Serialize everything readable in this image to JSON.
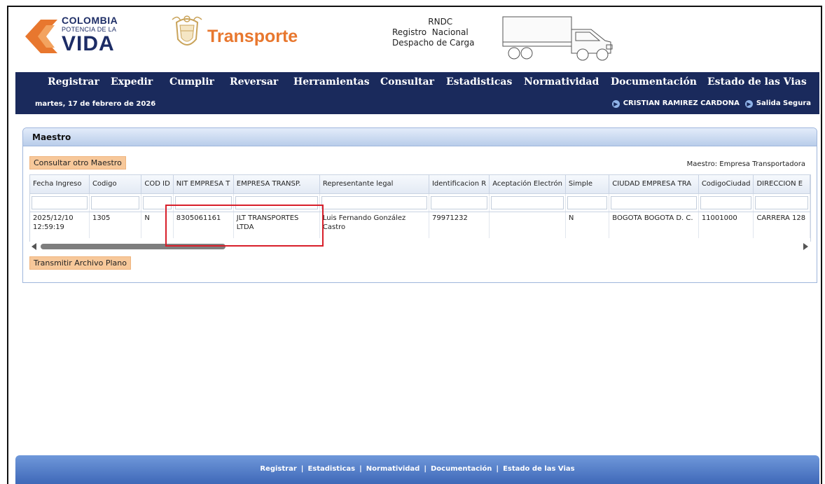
{
  "header": {
    "logo_line1": "COLOMBIA",
    "logo_line2": "POTENCIA DE LA",
    "logo_line3": "VIDA",
    "ministry": "Transporte",
    "rndc_title": "RNDC",
    "rndc_line1a": "Registro",
    "rndc_line1b": "Nacional",
    "rndc_line2": "Despacho de Carga"
  },
  "menu": {
    "items": [
      "Registrar",
      "Expedir",
      "Cumplir",
      "Reversar",
      "Herramientas",
      "Consultar",
      "Estadisticas",
      "Normatividad",
      "Documentación",
      "Estado de las Vias"
    ]
  },
  "subbar": {
    "date": "martes, 17 de febrero de 2026",
    "user": "CRISTIAN RAMIREZ CARDONA",
    "logout": "Salida Segura"
  },
  "panel": {
    "title": "Maestro",
    "consult_button": "Consultar otro Maestro",
    "maestro_label": "Maestro: Empresa Transportadora",
    "transmit_button": "Transmitir Archivo Plano"
  },
  "table": {
    "columns": [
      "Fecha Ingreso",
      "Codigo",
      "COD ID",
      "NIT EMPRESA T",
      "EMPRESA TRANSP.",
      "Representante legal",
      "Identificacion R",
      "Aceptación Electrón",
      "Simple",
      "CIUDAD EMPRESA TRA",
      "CodigoCiudad",
      "DIRECCION E"
    ],
    "row": [
      "2025/12/10 12:59:19",
      "1305",
      "N",
      "8305061161",
      "JLT TRANSPORTES LTDA",
      "Luis Fernando González Castro",
      "79971232",
      "",
      "N",
      "BOGOTA BOGOTA D. C.",
      "11001000",
      "CARRERA 128"
    ]
  },
  "footer": {
    "links": [
      "Registrar",
      "Estadisticas",
      "Normatividad",
      "Documentación",
      "Estado de las Vias"
    ],
    "separator": "|"
  },
  "colors": {
    "nav": "#1a2a5c",
    "accent_orange": "#e8772e",
    "button_bg": "#f7c89a",
    "highlight": "#d81f2a",
    "footer": "#4f78c8"
  }
}
